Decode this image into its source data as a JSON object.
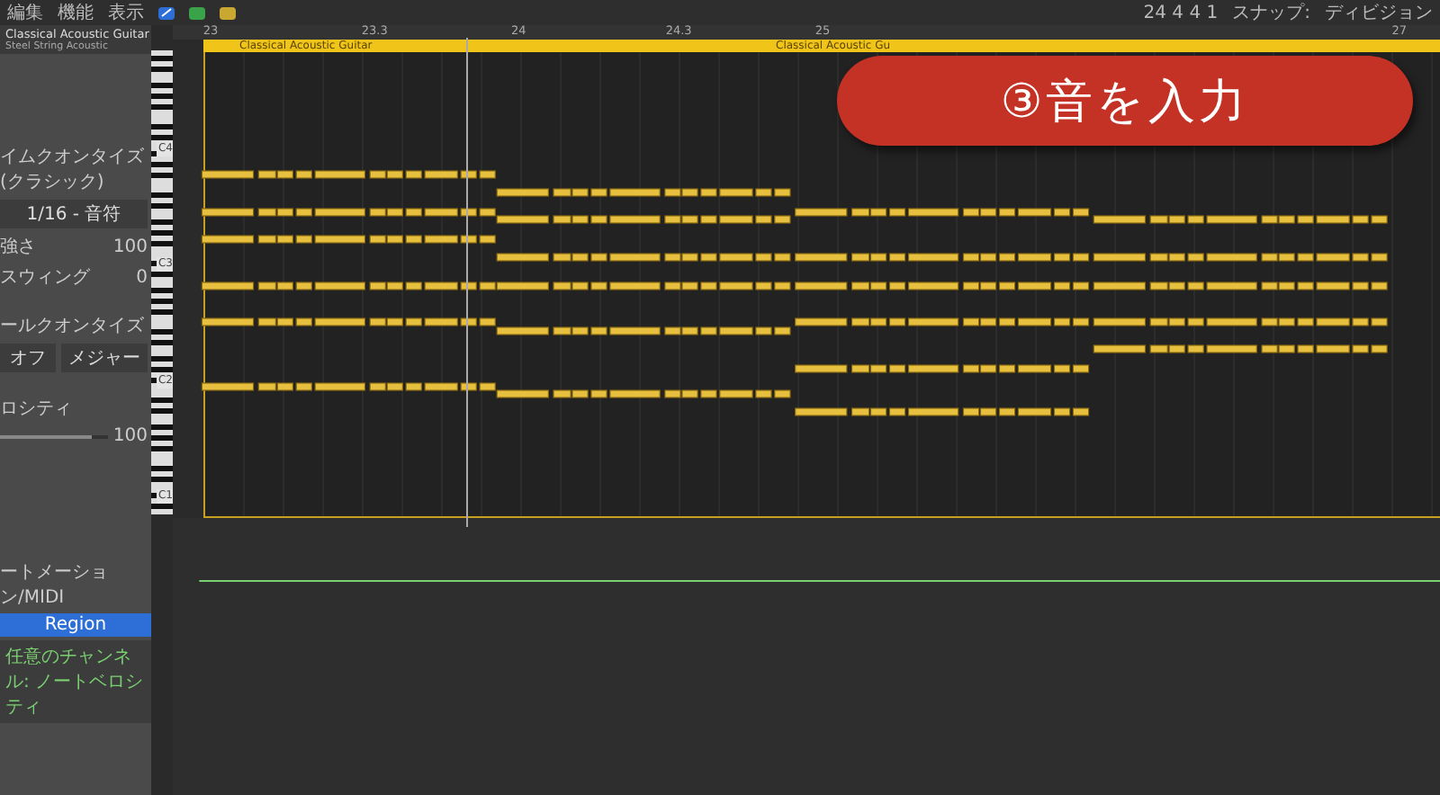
{
  "toolbar": {
    "menus": [
      "編集",
      "機能",
      "表示"
    ],
    "position": "24 4 4 1",
    "snap_label": "スナップ:",
    "snap_value": "ディビジョン"
  },
  "track": {
    "name": "Classical Acoustic Guitar",
    "patch": "Steel String Acoustic"
  },
  "inspector": {
    "time_quantize": {
      "title": "イムクオンタイズ (クラシック)",
      "value": "1/16 - 音符",
      "strength_label": "強さ",
      "strength": "100",
      "swing_label": "スウィング",
      "swing": "0"
    },
    "scale_quantize": {
      "title": "ールクオンタイズ",
      "root": "オフ",
      "scale": "メジャー"
    },
    "velocity": {
      "title": "ロシティ",
      "value": "100",
      "level": 0.85
    }
  },
  "ruler": {
    "marks": [
      "23",
      "23.3",
      "24",
      "24.3",
      "25",
      "27"
    ]
  },
  "regions": [
    {
      "name": "Classical Acoustic Guitar"
    },
    {
      "name": "Classical Acoustic Gu"
    }
  ],
  "piano_keys": {
    "labels": [
      "C4",
      "C3",
      "C2",
      "C1"
    ]
  },
  "automation": {
    "title": "ートメーション/MIDI",
    "mode": "Region",
    "parameter": "任意のチャンネル: ノートベロシティ"
  },
  "banner": {
    "text": "③音を入力"
  }
}
